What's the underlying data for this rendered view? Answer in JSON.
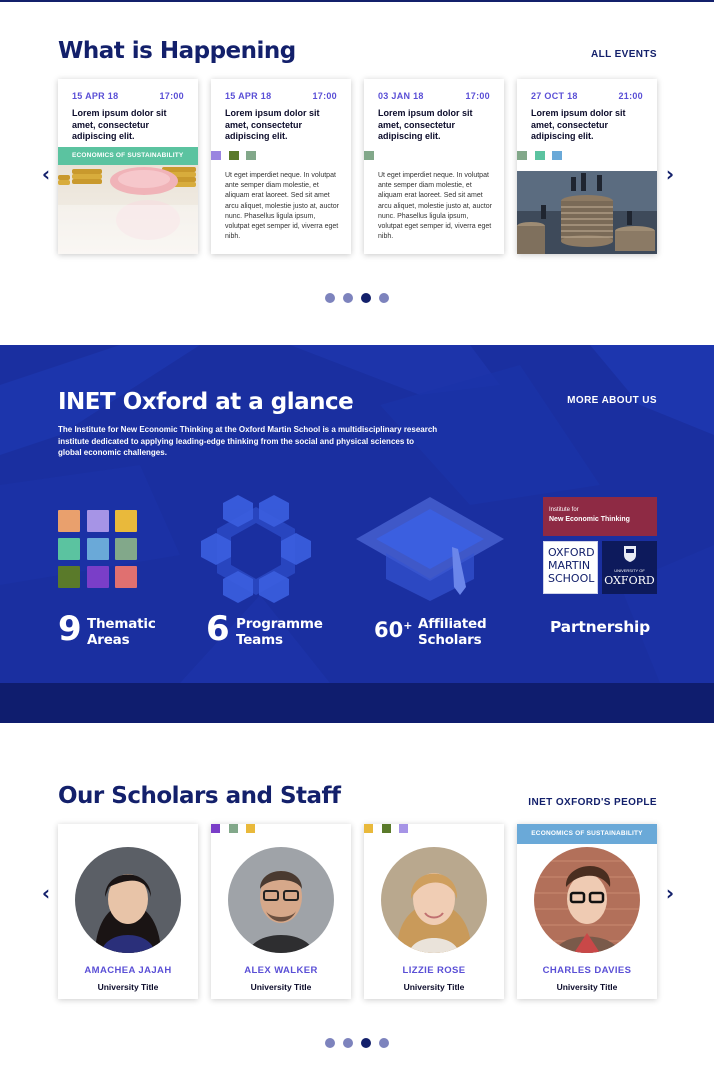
{
  "happening": {
    "title": "What is Happening",
    "link": "ALL EVENTS",
    "cards": [
      {
        "date": "15 APR 18",
        "time": "17:00",
        "title": "Lorem ipsum dolor sit amet, consectetur adipiscing elit.",
        "tag": "ECONOMICS OF SUSTAINABILITY",
        "body": ""
      },
      {
        "date": "15 APR 18",
        "time": "17:00",
        "title": "Lorem ipsum dolor sit amet, consectetur adipiscing elit.",
        "tag": "",
        "body": "Ut eget imperdiet neque. In volutpat ante semper diam molestie, et aliquam erat laoreet. Sed sit amet arcu aliquet, molestie justo at, auctor nunc. Phasellus ligula ipsum, volutpat eget semper id, viverra eget nibh."
      },
      {
        "date": "03 JAN 18",
        "time": "17:00",
        "title": "Lorem ipsum dolor sit amet, consectetur adipiscing elit.",
        "tag": "",
        "body": "Ut eget imperdiet neque. In volutpat ante semper diam molestie, et aliquam erat laoreet. Sed sit amet arcu aliquet, molestie justo at, auctor nunc. Phasellus ligula ipsum, volutpat eget semper id, viverra eget nibh."
      },
      {
        "date": "27 OCT 18",
        "time": "21:00",
        "title": "Lorem ipsum dolor sit amet, consectetur adipiscing elit.",
        "tag": "",
        "body": ""
      }
    ],
    "active_page": 3,
    "page_count": 4
  },
  "glance": {
    "title": "INET Oxford at a glance",
    "link": "MORE ABOUT US",
    "description": "The Institute for New Economic Thinking at the Oxford Martin School is a multidisciplinary research institute dedicated to applying leading-edge thinking from the social and physical sciences to global economic challenges.",
    "stats": [
      {
        "number": "9",
        "label_line1": "Thematic",
        "label_line2": "Areas"
      },
      {
        "number": "6",
        "label_line1": "Programme",
        "label_line2": "Teams"
      },
      {
        "number": "60",
        "sup": "+",
        "label_line1": "Affiliated",
        "label_line2": "Scholars"
      },
      {
        "label": "Partnership"
      }
    ],
    "partner_logos": {
      "inet_line1": "Institute for",
      "inet_line2": "New Economic Thinking",
      "oms_line1": "OXFORD",
      "oms_line2": "MARTIN",
      "oms_line3": "SCHOOL",
      "uni_small": "UNIVERSITY OF",
      "uni_big": "OXFORD"
    },
    "colors": {
      "background": "#1a2fa0",
      "dark": "#0f1d6e"
    }
  },
  "scholars": {
    "title": "Our Scholars and Staff",
    "link": "INET OXFORD'S PEOPLE",
    "people": [
      {
        "name": "AMACHEA JAJAH",
        "title": "University Title",
        "tag": ""
      },
      {
        "name": "ALEX WALKER",
        "title": "University Title",
        "tag": ""
      },
      {
        "name": "LIZZIE ROSE",
        "title": "University Title",
        "tag": ""
      },
      {
        "name": "CHARLES DAVIES",
        "title": "University Title",
        "tag": "ECONOMICS OF SUSTAINABILITY"
      }
    ],
    "active_page": 3,
    "page_count": 4
  },
  "icons": {
    "prev": "chevron-left-icon",
    "next": "chevron-right-icon"
  }
}
